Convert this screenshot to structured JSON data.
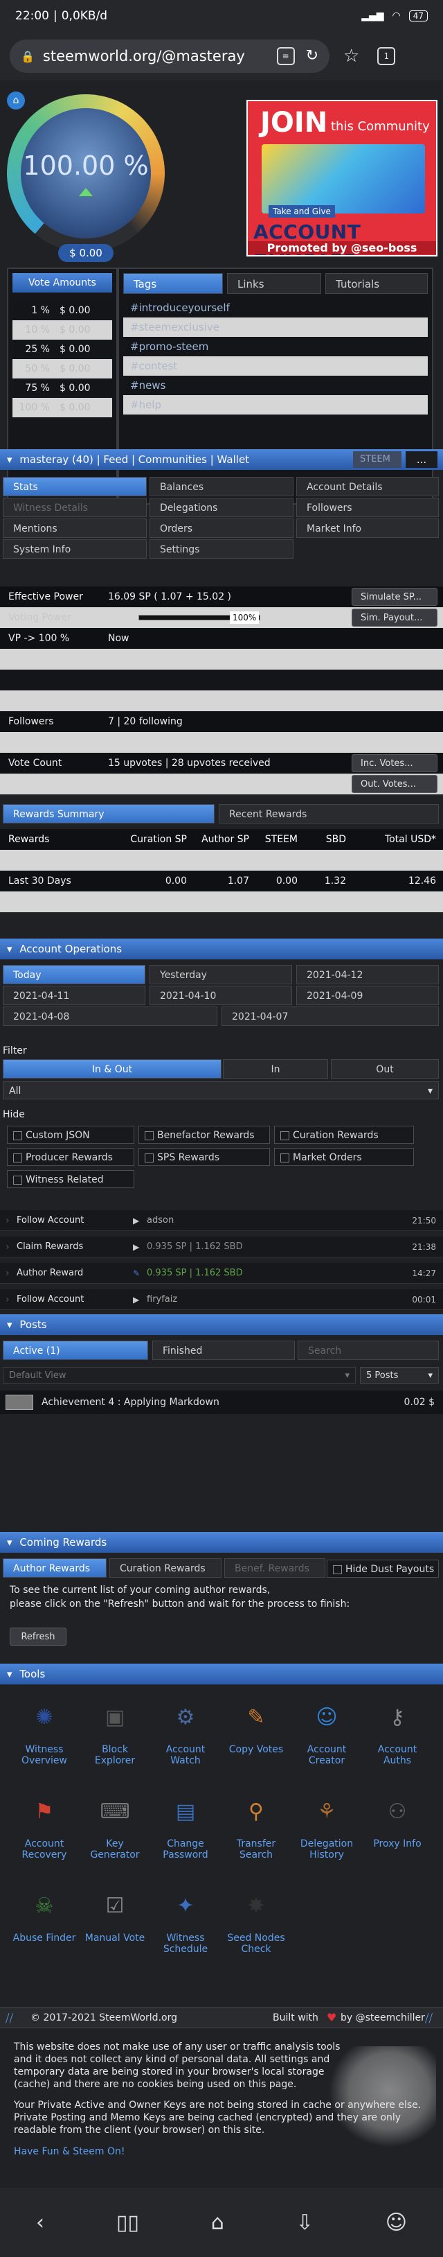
{
  "status": {
    "time": "22:00",
    "net": "0,0KB/d",
    "battery": "47"
  },
  "browser": {
    "url": "steemworld.org/@masteray",
    "tabs_count": "1"
  },
  "gauge": {
    "percent": "100.00 %",
    "money": "$ 0.00",
    "fill": 1.0
  },
  "ad": {
    "join": "JOIN",
    "community": "this Community",
    "tagline": "Take and Give",
    "booster": "ACCOUNT BOOSTER",
    "promoted": "Promoted by @seo-boss"
  },
  "vote_amounts": {
    "header": "Vote Amounts",
    "rows": [
      {
        "pct": "1 %",
        "val": "$ 0.00"
      },
      {
        "pct": "10 %",
        "val": "$ 0.00"
      },
      {
        "pct": "25 %",
        "val": "$ 0.00"
      },
      {
        "pct": "50 %",
        "val": "$ 0.00"
      },
      {
        "pct": "75 %",
        "val": "$ 0.00"
      },
      {
        "pct": "100 %",
        "val": "$ 0.00"
      }
    ]
  },
  "tags_panel": {
    "tabs": [
      "Tags",
      "Links",
      "Tutorials"
    ],
    "tags": [
      "#introduceyourself",
      "#steemexclusive",
      "#promo-steem",
      "#contest",
      "#news",
      "#help"
    ]
  },
  "account_bar": {
    "title": "masteray (40)  |  Feed  |  Communities  |  Wallet",
    "currency": "STEEM",
    "more": "..."
  },
  "menu": {
    "items": [
      [
        "Stats",
        "Balances",
        "Account Details"
      ],
      [
        "Witness Details",
        "Delegations",
        "Followers"
      ],
      [
        "Mentions",
        "Orders",
        "Market Info"
      ],
      [
        "System Info",
        "Settings",
        ""
      ]
    ]
  },
  "stats": {
    "effective_power_label": "Effective Power",
    "effective_power_value": "16.09 SP ( 1.07 + 15.02 )",
    "simulate_sp": "Simulate SP...",
    "voting_power_label": "Voting Power",
    "voting_power_pct": "100%",
    "voting_power_fill": 1.0,
    "sim_payout": "Sim. Payout...",
    "vp_label": "VP -> 100 %",
    "vp_value": "Now",
    "followers_label": "Followers",
    "followers_value": "7  |  20 following",
    "vote_count_label": "Vote Count",
    "vote_count_value": "15 upvotes  |  28 upvotes received",
    "inc_votes": "Inc. Votes...",
    "out_votes": "Out. Votes..."
  },
  "rewards": {
    "tabs": [
      "Rewards Summary",
      "Recent Rewards"
    ],
    "headers": [
      "Rewards",
      "Curation SP",
      "Author SP",
      "STEEM",
      "SBD",
      "Total USD*"
    ],
    "last30": [
      "Last 30 Days",
      "0.00",
      "1.07",
      "0.00",
      "1.32",
      "12.46"
    ]
  },
  "ops": {
    "header": "Account Operations",
    "dates": [
      "Today",
      "Yesterday",
      "2021-04-12",
      "2021-04-11",
      "2021-04-10",
      "2021-04-09",
      "2021-04-08",
      "2021-04-07"
    ],
    "filter_label": "Filter",
    "filter_tabs": [
      "In & Out",
      "In",
      "Out"
    ],
    "select_value": "All",
    "hide_label": "Hide",
    "hide_opts": [
      "Custom JSON",
      "Benefactor Rewards",
      "Curation Rewards",
      "Producer Rewards",
      "SPS Rewards",
      "Market Orders",
      "Witness Related"
    ],
    "list": [
      {
        "type": "Follow Account",
        "detail": "adson",
        "time": "21:50"
      },
      {
        "type": "Claim Rewards",
        "detail": "0.935 SP  |  1.162 SBD",
        "time": "21:38"
      },
      {
        "type": "Author Reward",
        "detail": "0.935 SP  |  1.162 SBD",
        "time": "14:27"
      },
      {
        "type": "Follow Account",
        "detail": "firyfaiz",
        "time": "00:01"
      }
    ]
  },
  "posts": {
    "header": "Posts",
    "tabs": [
      "Active (1)",
      "Finished"
    ],
    "search_placeholder": "Search",
    "view": "Default View",
    "count": "5 Posts",
    "items": [
      {
        "title": "Achievement 4 : Applying Markdown",
        "value": "0.02 $"
      }
    ]
  },
  "coming": {
    "header": "Coming Rewards",
    "tabs": [
      "Author Rewards",
      "Curation Rewards",
      "Benef. Rewards"
    ],
    "hide_dust": "Hide Dust Payouts",
    "info1": "To see the current list of your coming author rewards,",
    "info2": "please click on the \"Refresh\" button and wait for the process to finish:",
    "refresh": "Refresh"
  },
  "tools": {
    "header": "Tools",
    "items": [
      "Witness Overview",
      "Block Explorer",
      "Account Watch",
      "Copy Votes",
      "Account Creator",
      "Account Auths",
      "Account Recovery",
      "Key Generator",
      "Change Password",
      "Transfer Search",
      "Delegation History",
      "Proxy Info",
      "Abuse Finder",
      "Manual Vote",
      "Witness Schedule",
      "Seed Nodes Check"
    ]
  },
  "footer": {
    "copyright": "© 2017-2021 SteemWorld.org",
    "built": "Built with",
    "by": "by @steemchiller",
    "p1": "This website does not make use of any user or traffic analysis tools and it does not collect any kind of personal data. All settings and temporary data are being stored in your browser's local storage (cache) and there are no cookies being used on this page.",
    "p2": "Your Private Active and Owner Keys are not being stored in cache or anywhere else. Private Posting and Memo Keys are being cached (encrypted) and they are only readable from the client (your browser) on this site.",
    "fun": "Have Fun & Steem On!"
  }
}
